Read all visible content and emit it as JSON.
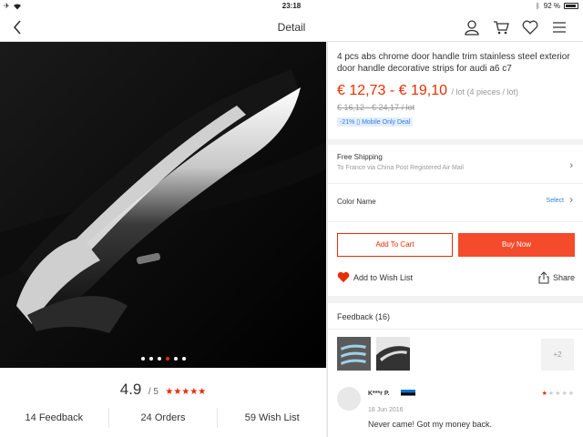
{
  "status_bar": {
    "time": "23:18",
    "battery": "92 %"
  },
  "nav": {
    "title": "Detail"
  },
  "gallery": {
    "image_count": 6,
    "active_index": 3
  },
  "rating": {
    "score": "4.9",
    "outof": "/ 5",
    "stars": "★★★★★"
  },
  "stats": {
    "feedback": "14 Feedback",
    "orders": "24 Orders",
    "wishlist": "59 Wish List"
  },
  "product": {
    "title": "4 pcs abs chrome door handle trim stainless steel exterior door handle decorative strips for audi a6 c7",
    "price": "€ 12,73 - € 19,10",
    "price_unit": "/ lot (4 pieces / lot)",
    "old_price": "€ 16,12 - € 24,17",
    "old_price_unit": "/ lot",
    "deal_badge": "-21% ▯ Mobile Only Deal"
  },
  "shipping": {
    "label": "Free Shipping",
    "detail": "To France via China Post Registered Air Mail"
  },
  "color": {
    "label": "Color Name",
    "select": "Select"
  },
  "actions": {
    "add_to_cart": "Add To Cart",
    "buy_now": "Buy Now",
    "add_to_wishlist": "Add to Wish List",
    "share": "Share"
  },
  "feedback": {
    "heading": "Feedback (16)",
    "more_photos": "+2",
    "review": {
      "user": "K***r P.",
      "date": "18 Jun 2016",
      "comment": "Never came! Got my money back.",
      "rating": 1,
      "rating_filled": "★",
      "rating_empty": "★★★★"
    }
  },
  "colors": {
    "accent": "#e62e04",
    "buy_button": "#f44b2c",
    "link": "#2f7ee6"
  }
}
